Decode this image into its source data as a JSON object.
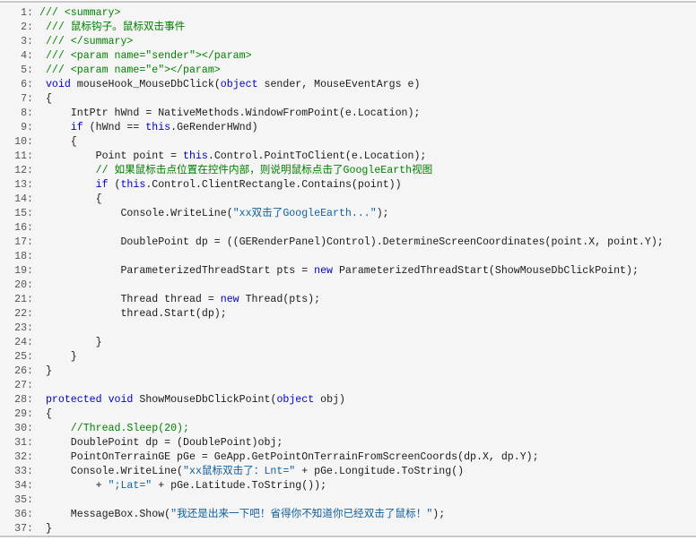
{
  "colors": {
    "keyword": "#0000cc",
    "comment": "#008000",
    "string": "#1060a0",
    "text": "#1a1a1a",
    "line_number": "#555555",
    "background": "#f5f5f5"
  },
  "lines": [
    [
      [
        "/// <summary>",
        "c"
      ]
    ],
    [
      [
        " /// 鼠标钩子。鼠标双击事件",
        "c"
      ]
    ],
    [
      [
        " /// </summary>",
        "c"
      ]
    ],
    [
      [
        " /// <param name=\"sender\"></param>",
        "c"
      ]
    ],
    [
      [
        " /// <param name=\"e\"></param>",
        "c"
      ]
    ],
    [
      [
        " ",
        ""
      ],
      [
        "void",
        "k"
      ],
      [
        " mouseHook_MouseDbClick(",
        ""
      ],
      [
        "object",
        "k"
      ],
      [
        " sender, MouseEventArgs e)",
        ""
      ]
    ],
    [
      [
        " {",
        ""
      ]
    ],
    [
      [
        "     IntPtr hWnd = NativeMethods.WindowFromPoint(e.Location);",
        ""
      ]
    ],
    [
      [
        "     ",
        ""
      ],
      [
        "if",
        "k"
      ],
      [
        " (hWnd == ",
        ""
      ],
      [
        "this",
        "k"
      ],
      [
        ".GeRenderHWnd)",
        ""
      ]
    ],
    [
      [
        "     {",
        ""
      ]
    ],
    [
      [
        "         Point point = ",
        ""
      ],
      [
        "this",
        "k"
      ],
      [
        ".Control.PointToClient(e.Location);",
        ""
      ]
    ],
    [
      [
        "         // 如果鼠标击点位置在控件内部，则说明鼠标点击了GoogleEarth视图",
        "c"
      ]
    ],
    [
      [
        "         ",
        ""
      ],
      [
        "if",
        "k"
      ],
      [
        " (",
        ""
      ],
      [
        "this",
        "k"
      ],
      [
        ".Control.ClientRectangle.Contains(point))",
        ""
      ]
    ],
    [
      [
        "         {",
        ""
      ]
    ],
    [
      [
        "             Console.WriteLine(",
        ""
      ],
      [
        "\"xx双击了GoogleEarth...\"",
        "s"
      ],
      [
        ");",
        ""
      ]
    ],
    [
      [
        "",
        ""
      ]
    ],
    [
      [
        "             DoublePoint dp = ((GERenderPanel)Control).DetermineScreenCoordinates(point.X, point.Y);",
        ""
      ]
    ],
    [
      [
        "",
        ""
      ]
    ],
    [
      [
        "             ParameterizedThreadStart pts = ",
        ""
      ],
      [
        "new",
        "k"
      ],
      [
        " ParameterizedThreadStart(ShowMouseDbClickPoint);",
        ""
      ]
    ],
    [
      [
        "",
        ""
      ]
    ],
    [
      [
        "             Thread thread = ",
        ""
      ],
      [
        "new",
        "k"
      ],
      [
        " Thread(pts);",
        ""
      ]
    ],
    [
      [
        "             thread.Start(dp);",
        ""
      ]
    ],
    [
      [
        "",
        ""
      ]
    ],
    [
      [
        "         }",
        ""
      ]
    ],
    [
      [
        "     }",
        ""
      ]
    ],
    [
      [
        " }",
        ""
      ]
    ],
    [
      [
        "",
        ""
      ]
    ],
    [
      [
        " ",
        ""
      ],
      [
        "protected",
        "k"
      ],
      [
        " ",
        ""
      ],
      [
        "void",
        "k"
      ],
      [
        " ShowMouseDbClickPoint(",
        ""
      ],
      [
        "object",
        "k"
      ],
      [
        " obj)",
        ""
      ]
    ],
    [
      [
        " {",
        ""
      ]
    ],
    [
      [
        "     //Thread.Sleep(20);",
        "c"
      ]
    ],
    [
      [
        "     DoublePoint dp = (DoublePoint)obj;",
        ""
      ]
    ],
    [
      [
        "     PointOnTerrainGE pGe = GeApp.GetPointOnTerrainFromScreenCoords(dp.X, dp.Y);",
        ""
      ]
    ],
    [
      [
        "     Console.WriteLine(",
        ""
      ],
      [
        "\"xx鼠标双击了：Lnt=\"",
        "s"
      ],
      [
        " + pGe.Longitude.ToString()",
        ""
      ]
    ],
    [
      [
        "         + ",
        ""
      ],
      [
        "\";Lat=\"",
        "s"
      ],
      [
        " + pGe.Latitude.ToString());",
        ""
      ]
    ],
    [
      [
        "",
        ""
      ]
    ],
    [
      [
        "     MessageBox.Show(",
        ""
      ],
      [
        "\"我还是出来一下吧！省得你不知道你已经双击了鼠标！\"",
        "s"
      ],
      [
        ");",
        ""
      ]
    ],
    [
      [
        " }",
        ""
      ]
    ]
  ]
}
